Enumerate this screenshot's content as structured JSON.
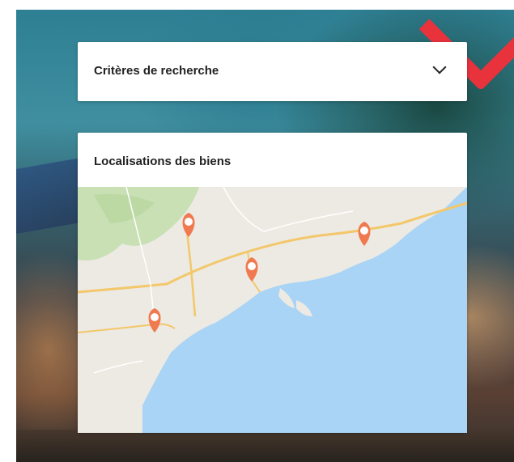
{
  "search_criteria": {
    "title": "Critères de recherche",
    "toggle_icon": "chevron-down-icon"
  },
  "locations": {
    "title": "Localisations des biens",
    "map_pin_count": 4,
    "colors": {
      "pin": "#f0794f",
      "sea": "#a9d4f5",
      "land": "#eceae3",
      "park": "#c8e0b4"
    }
  },
  "brand_color": "#e8323c"
}
